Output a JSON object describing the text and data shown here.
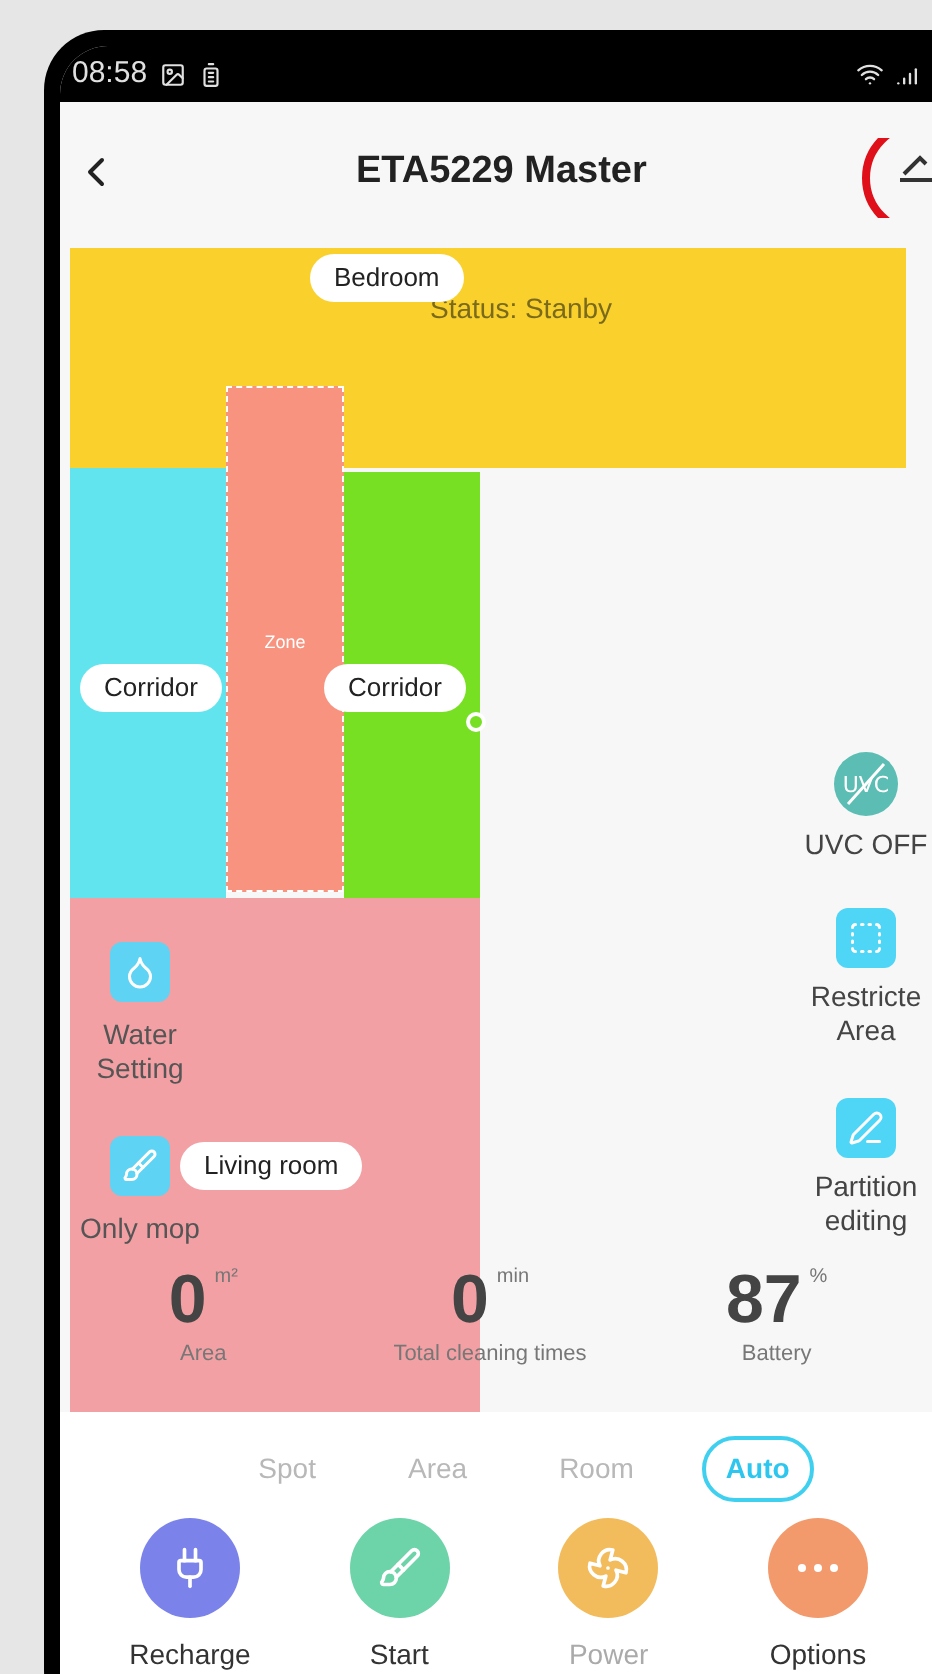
{
  "status_bar": {
    "time": "08:58"
  },
  "header": {
    "title": "ETA5229 Master"
  },
  "map": {
    "status": "Status: Stanby",
    "zone_label": "Zone",
    "rooms": [
      {
        "name": "Bedroom",
        "kind": "bedroom"
      },
      {
        "name": "Corridor",
        "kind": "corridor_left"
      },
      {
        "name": "Corridor",
        "kind": "corridor_right"
      },
      {
        "name": "Living room",
        "kind": "living"
      }
    ],
    "left_controls": [
      {
        "label": "Water Setting",
        "kind": "water"
      },
      {
        "label": "Only mop",
        "kind": "mop"
      }
    ],
    "right_controls": [
      {
        "label": "UVC OFF",
        "kind": "uvc",
        "icon_text": "UVC"
      },
      {
        "label": "Restricte\nArea",
        "kind": "restricted"
      },
      {
        "label": "Partition\nediting",
        "kind": "partition"
      }
    ]
  },
  "stats": [
    {
      "value": "0",
      "unit": "m²",
      "label": "Area"
    },
    {
      "value": "0",
      "unit": "min",
      "label": "Total cleaning times"
    },
    {
      "value": "87",
      "unit": "%",
      "label": "Battery"
    }
  ],
  "modes": [
    {
      "label": "Spot",
      "selected": false
    },
    {
      "label": "Area",
      "selected": false
    },
    {
      "label": "Room",
      "selected": false
    },
    {
      "label": "Auto",
      "selected": true
    }
  ],
  "actions": [
    {
      "label": "Recharge",
      "kind": "plug",
      "color": "#7b83eb",
      "disabled": false
    },
    {
      "label": "Start",
      "kind": "broom",
      "color": "#6dd3a8",
      "disabled": false
    },
    {
      "label": "Power",
      "kind": "fan",
      "color": "#f2bc5c",
      "disabled": true
    },
    {
      "label": "Options",
      "kind": "more",
      "color": "#f39a6c",
      "disabled": false
    }
  ]
}
